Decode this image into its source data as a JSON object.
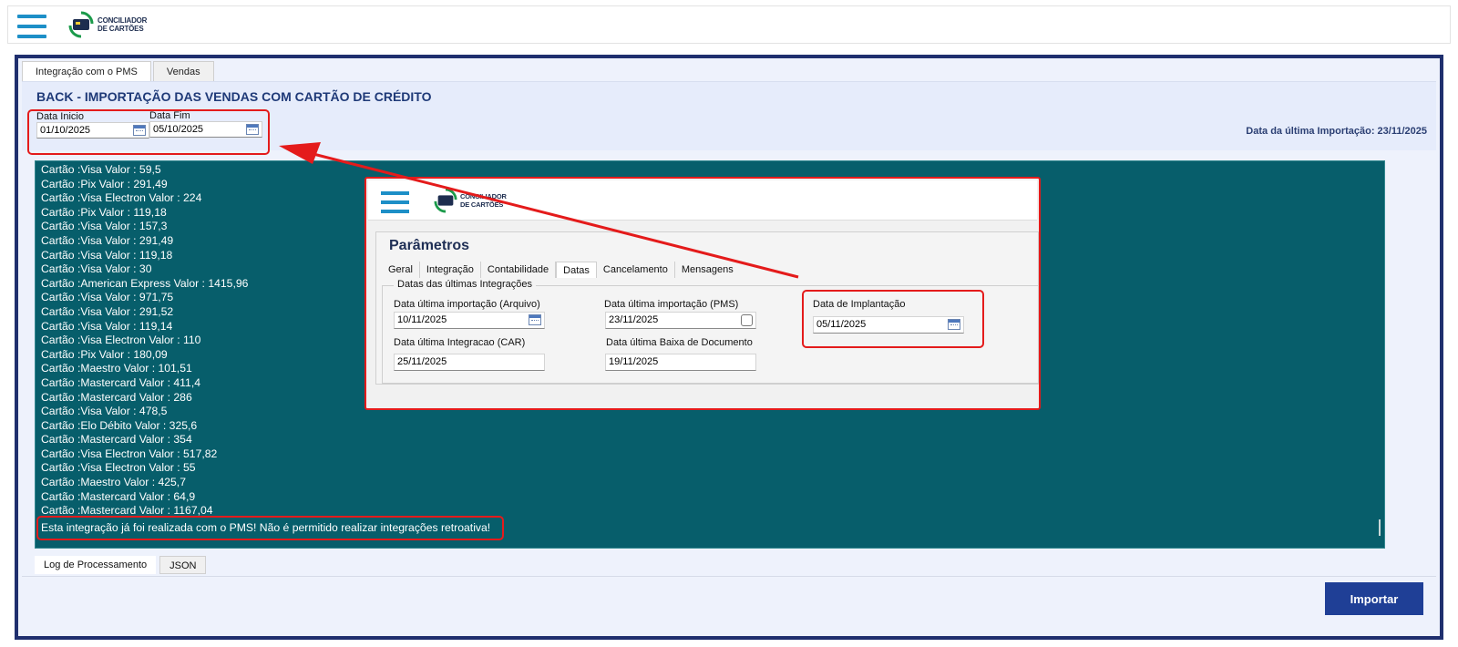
{
  "app": {
    "logo_line1": "CONCILIADOR",
    "logo_line2": "DE CARTÕES"
  },
  "tabs_top": [
    {
      "label": "Integração com o PMS",
      "active": true
    },
    {
      "label": "Vendas",
      "active": false
    }
  ],
  "header": {
    "title": "BACK - IMPORTAÇÃO DAS VENDAS COM CARTÃO DE CRÉDITO",
    "date_start_label": "Data Inicio",
    "date_start_value": "01/10/2025",
    "date_end_label": "Data Fim",
    "date_end_value": "05/10/2025",
    "last_import": "Data da última Importação: 23/11/2025"
  },
  "log": {
    "lines": [
      "Cartão :Visa Valor : 59,5",
      "Cartão :Pix Valor : 291,49",
      "Cartão :Visa Electron Valor : 224",
      "Cartão :Pix Valor : 119,18",
      "Cartão :Visa Valor : 157,3",
      "Cartão :Visa Valor : 291,49",
      "Cartão :Visa Valor : 119,18",
      "Cartão :Visa Valor : 30",
      "Cartão :American Express Valor : 1415,96",
      "Cartão :Visa Valor : 971,75",
      "Cartão :Visa Valor : 291,52",
      "Cartão :Visa Valor : 119,14",
      "Cartão :Visa Electron Valor : 110",
      "Cartão :Pix Valor : 180,09",
      "Cartão :Maestro Valor : 101,51",
      "Cartão :Mastercard Valor : 411,4",
      "Cartão :Mastercard Valor : 286",
      "Cartão :Visa Valor : 478,5",
      "Cartão :Elo Débito Valor : 325,6",
      "Cartão :Mastercard Valor : 354",
      "Cartão :Visa Electron Valor : 517,82",
      "Cartão :Visa Electron Valor : 55",
      "Cartão :Maestro Valor : 425,7",
      "Cartão :Mastercard Valor : 64,9",
      "Cartão :Mastercard Valor : 1167,04"
    ],
    "error_message": "Esta integração já foi realizada com o PMS! Não é permitido realizar integrações retroativa!"
  },
  "inner": {
    "logo_line1": "CONCILIADOR",
    "logo_line2": "DE CARTÕES",
    "title": "Parâmetros",
    "tabs": [
      {
        "label": "Geral",
        "active": false
      },
      {
        "label": "Integração",
        "active": false
      },
      {
        "label": "Contabilidade",
        "active": false
      },
      {
        "label": "Datas",
        "active": true
      },
      {
        "label": "Cancelamento",
        "active": false
      },
      {
        "label": "Mensagens",
        "active": false
      }
    ],
    "group_title": "Datas das últimas Integrações",
    "field_import_arquivo_label": "Data última importação (Arquivo)",
    "field_import_arquivo_value": "10/11/2025",
    "field_import_pms_label": "Data última importação (PMS)",
    "field_import_pms_value": "23/11/2025",
    "field_implantacao_label": "Data de Implantação",
    "field_implantacao_value": "05/11/2025",
    "field_integracao_car_label": "Data última Integracao (CAR)",
    "field_integracao_car_value": "25/11/2025",
    "field_baixa_label": "Data última Baixa de Documento",
    "field_baixa_value": "19/11/2025"
  },
  "bottom_tabs": [
    {
      "label": "Log de Processamento",
      "active": true
    },
    {
      "label": "JSON",
      "active": false
    }
  ],
  "actions": {
    "import_label": "Importar"
  },
  "colors": {
    "accent": "#1f2f6e",
    "log_bg": "#075e6b",
    "highlight": "#e41b1b",
    "button": "#1f3f96"
  }
}
